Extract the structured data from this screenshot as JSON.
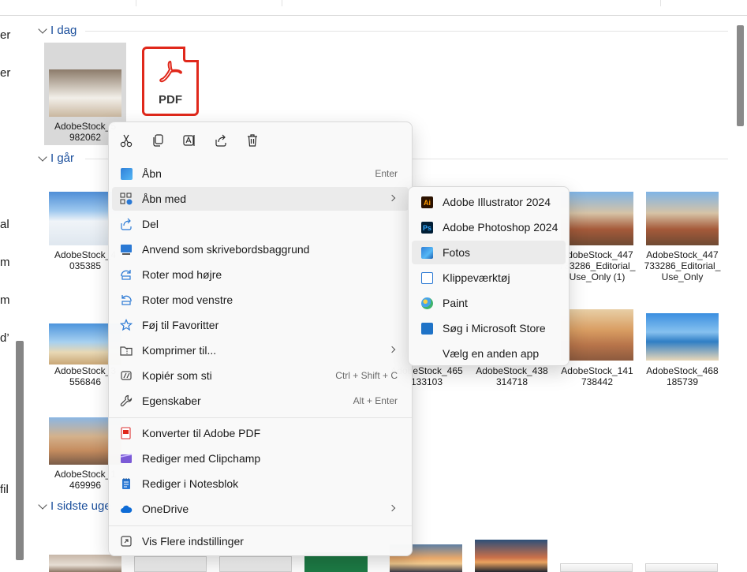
{
  "nav_pane": {
    "partial_letters": [
      "er",
      "er",
      "al",
      "m",
      "m",
      "d’",
      "fil"
    ]
  },
  "groups": {
    "today": "I dag",
    "yesterday": "I går",
    "last_week": "I sidste uge"
  },
  "files": {
    "today": [
      {
        "name": "AdobeStock_5\n982062",
        "selected": true
      },
      {
        "name": "",
        "kind": "pdf",
        "icon_text": "PDF"
      }
    ],
    "yesterday_row1": [
      {
        "name": "AdobeStock_4\n035385"
      },
      {
        "name": "AdobeStock_447\n733286_Editorial_\nUse_Only (1)"
      },
      {
        "name": "AdobeStock_447\n733286_Editorial_\nUse_Only"
      }
    ],
    "yesterday_row2": [
      {
        "name": "AdobeStock_3\n556846"
      },
      {
        "name": "AdobeStock_465\n133103"
      },
      {
        "name": "AdobeStock_438\n314718"
      },
      {
        "name": "AdobeStock_141\n738442"
      },
      {
        "name": "AdobeStock_468\n185739"
      }
    ],
    "yesterday_row3": [
      {
        "name": "AdobeStock_1\n469996"
      }
    ]
  },
  "context_menu": {
    "quick_actions": [
      "cut",
      "copy",
      "rename",
      "share",
      "delete"
    ],
    "items": [
      {
        "label": "Åbn",
        "shortcut": "Enter",
        "icon": "photos-icon"
      },
      {
        "label": "Åbn med",
        "submenu": true,
        "icon": "open-with-icon"
      },
      {
        "label": "Del",
        "icon": "share-icon"
      },
      {
        "label": "Anvend som skrivebordsbaggrund",
        "icon": "wallpaper-icon"
      },
      {
        "label": "Roter mod højre",
        "icon": "rotate-right-icon"
      },
      {
        "label": "Roter mod venstre",
        "icon": "rotate-left-icon"
      },
      {
        "label": "Føj til Favoritter",
        "icon": "star-icon"
      },
      {
        "label": "Komprimer til...",
        "submenu": true,
        "icon": "zip-icon"
      },
      {
        "label": "Kopiér som sti",
        "shortcut": "Ctrl + Shift + C",
        "icon": "copy-path-icon"
      },
      {
        "label": "Egenskaber",
        "shortcut": "Alt + Enter",
        "icon": "wrench-icon"
      },
      {
        "label": "Konverter til Adobe PDF",
        "icon": "adobe-pdf-icon"
      },
      {
        "label": "Rediger med Clipchamp",
        "icon": "clipchamp-icon"
      },
      {
        "label": "Rediger i Notesblok",
        "icon": "notepad-icon"
      },
      {
        "label": "OneDrive",
        "submenu": true,
        "icon": "onedrive-icon"
      },
      {
        "label": "Vis Flere indstillinger",
        "icon": "more-options-icon"
      }
    ]
  },
  "open_with_submenu": {
    "items": [
      {
        "label": "Adobe Illustrator 2024",
        "icon_text": "Ai"
      },
      {
        "label": "Adobe Photoshop 2024",
        "icon_text": "Ps"
      },
      {
        "label": "Fotos",
        "highlighted": true
      },
      {
        "label": "Klippeværktøj"
      },
      {
        "label": "Paint"
      },
      {
        "label": "Søg i Microsoft Store"
      },
      {
        "label": "Vælg en anden app"
      }
    ]
  },
  "colors": {
    "group_header": "#1b4f9c",
    "pdf_red": "#e0281b",
    "menu_bg": "#f9f9f9",
    "hover": "#ebebeb"
  }
}
